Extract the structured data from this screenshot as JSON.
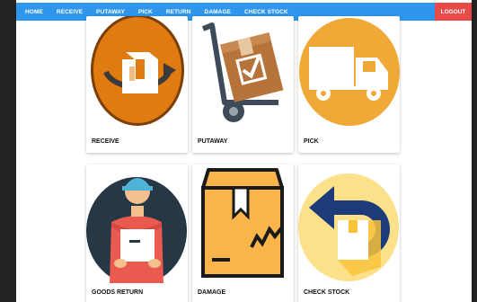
{
  "nav": {
    "items": [
      "HOME",
      "RECEIVE",
      "PUTAWAY",
      "PICK",
      "RETURN",
      "DAMAGE",
      "CHECK STOCK"
    ],
    "logout": "LOGOUT"
  },
  "colors": {
    "navbar": "#2f96ed",
    "logout": "#e84a4a",
    "receive_circle": "#e07b12",
    "pick_circle": "#f0a836",
    "check_circle": "#fde08a"
  },
  "tiles": [
    {
      "label": "RECEIVE",
      "icon": "receive-box-icon"
    },
    {
      "label": "PUTAWAY",
      "icon": "hand-truck-icon"
    },
    {
      "label": "PICK",
      "icon": "delivery-truck-icon"
    },
    {
      "label": "GOODS RETURN",
      "icon": "delivery-man-icon"
    },
    {
      "label": "DAMAGE",
      "icon": "damaged-box-icon"
    },
    {
      "label": "CHECK STOCK",
      "icon": "return-arrow-icon"
    }
  ]
}
